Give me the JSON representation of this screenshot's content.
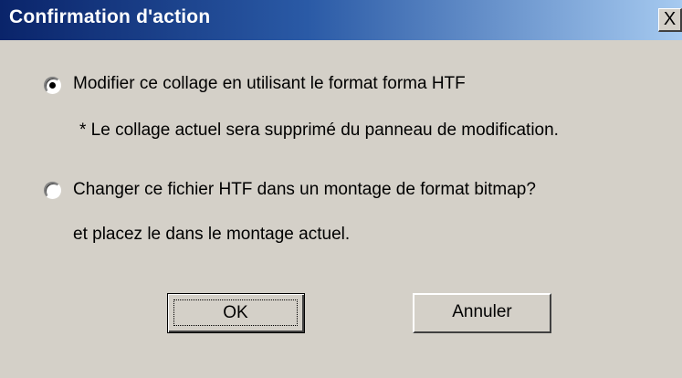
{
  "window": {
    "title": "Confirmation d'action",
    "close_glyph": "X"
  },
  "options": [
    {
      "label": "Modifier ce collage en utilisant le format forma HTF",
      "checked": true,
      "note": "* Le collage actuel sera supprimé du panneau de modification."
    },
    {
      "label": "Changer ce fichier HTF dans un montage de format bitmap?",
      "checked": false,
      "note": "et placez le dans le montage actuel."
    }
  ],
  "buttons": {
    "ok": "OK",
    "cancel": "Annuler"
  }
}
